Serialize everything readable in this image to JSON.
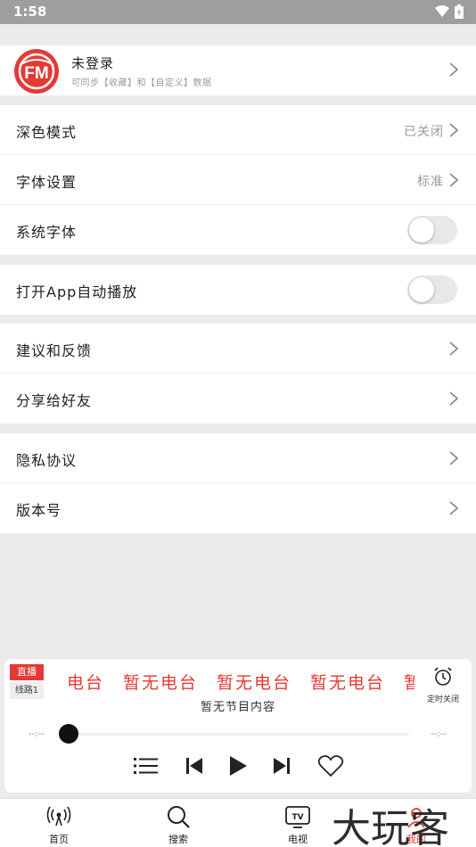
{
  "status_bar": {
    "time": "1:58"
  },
  "profile": {
    "logo_text": "FM",
    "name": "未登录",
    "subtitle": "可同步【收藏】和【自定义】数据"
  },
  "settings": {
    "dark_mode": {
      "label": "深色模式",
      "value": "已关闭"
    },
    "font_setting": {
      "label": "字体设置",
      "value": "标准"
    },
    "system_font": {
      "label": "系统字体",
      "enabled": false
    },
    "autoplay": {
      "label": "打开App自动播放",
      "enabled": false
    },
    "feedback": {
      "label": "建议和反馈"
    },
    "share": {
      "label": "分享给好友"
    },
    "privacy": {
      "label": "隐私协议"
    },
    "version": {
      "label": "版本号"
    }
  },
  "player": {
    "live_badge": "直播",
    "line_badge": "线路1",
    "marquee": "电台　暂无电台　暂无电台　暂无电台　暂",
    "program": "暂无节目内容",
    "timer_label": "定时关闭",
    "time_start": "--:--",
    "time_end": "--:--",
    "progress": 0
  },
  "tabs": [
    {
      "label": "首页",
      "icon": "broadcast-icon"
    },
    {
      "label": "搜索",
      "icon": "search-icon"
    },
    {
      "label": "电视",
      "icon": "tv-icon"
    },
    {
      "label": "我的",
      "icon": "profile-icon"
    }
  ],
  "watermark": "大玩客",
  "colors": {
    "accent": "#e53935",
    "background": "#ebebeb"
  }
}
